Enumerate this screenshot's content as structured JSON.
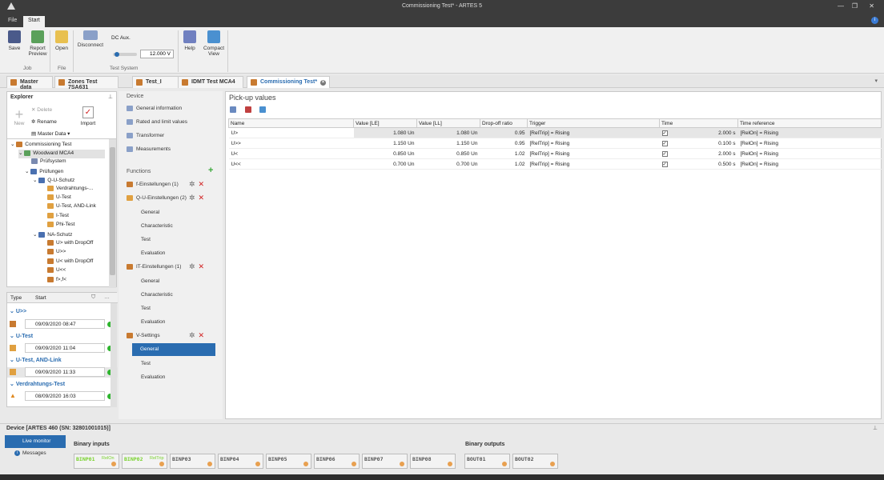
{
  "window": {
    "title": "Commissioning Test* - ARTES 5"
  },
  "menu": {
    "file": "File",
    "start": "Start"
  },
  "ribbon": {
    "save": "Save",
    "report_preview": "Report Preview",
    "open": "Open",
    "disconnect": "Disconnect",
    "dc_aux": "DC Aux.",
    "dc_aux_value": "12.000 V",
    "help": "Help",
    "compact_view": "Compact View",
    "group_job": "Job",
    "group_file": "File",
    "group_test_system": "Test System"
  },
  "tabs": [
    "Master data",
    "Zones Test 7SA631",
    "Test_I",
    "IDMT Test MCA4",
    "Commissioning Test*"
  ],
  "explorer": {
    "title": "Explorer",
    "delete": "Delete",
    "rename": "Rename",
    "new": "New",
    "master_data": "Master Data",
    "import": "Import",
    "tree": [
      {
        "label": "Commissioning Test",
        "level": 0
      },
      {
        "label": "Woodward MCA4",
        "level": 1
      },
      {
        "label": "Prüfsystem",
        "level": 2
      },
      {
        "label": "Prüfungen",
        "level": 2
      },
      {
        "label": "Q-U-Schutz",
        "level": 3
      },
      {
        "label": "Verdrahtungs-...",
        "level": 4
      },
      {
        "label": "U-Test",
        "level": 4
      },
      {
        "label": "U-Test, AND-Link",
        "level": 4
      },
      {
        "label": "I-Test",
        "level": 4
      },
      {
        "label": "Phi-Test",
        "level": 4
      },
      {
        "label": "NA-Schutz",
        "level": 3
      },
      {
        "label": "U> with DropOff",
        "level": 4
      },
      {
        "label": "U>>",
        "level": 4
      },
      {
        "label": "U< with DropOff",
        "level": 4
      },
      {
        "label": "U<<",
        "level": 4
      },
      {
        "label": "f>,f<",
        "level": 4
      }
    ]
  },
  "history": {
    "col_type": "Type",
    "col_start": "Start",
    "groups": [
      {
        "name": "U>>",
        "date": "09/09/2020 08:47"
      },
      {
        "name": "U-Test",
        "date": "09/09/2020 11:04"
      },
      {
        "name": "U-Test, AND-Link",
        "date": "09/09/2020 11:33"
      },
      {
        "name": "Verdrahtungs-Test",
        "date": "08/09/2020 16:03"
      }
    ]
  },
  "device": {
    "head": "Device",
    "items": [
      "General information",
      "Rated and limit values",
      "Transformer",
      "Measurements"
    ],
    "functions_head": "Functions",
    "functions": [
      {
        "name": "f-Einstellungen (1)",
        "subs": []
      },
      {
        "name": "Q-U-Einstellungen (2)",
        "subs": [
          "General",
          "Characteristic",
          "Test",
          "Evaluation"
        ]
      },
      {
        "name": "IT-Einstellungen (1)",
        "subs": [
          "General",
          "Characteristic",
          "Test",
          "Evaluation"
        ]
      },
      {
        "name": "V-Settings",
        "subs": [
          "General",
          "Test",
          "Evaluation"
        ]
      }
    ]
  },
  "pickup": {
    "title": "Pick-up values",
    "columns": [
      "Name",
      "Value [LE]",
      "Value [LL]",
      "Drop-off ratio",
      "Trigger",
      "Time",
      "Time reference"
    ],
    "rows": [
      {
        "name": "U>",
        "le": "1.080 Un",
        "ll": "1.080 Un",
        "ratio": "0.95",
        "trigger": "[RelTrip] = Rising",
        "time": "2.000 s",
        "ref": "[RelOn] = Rising"
      },
      {
        "name": "U>>",
        "le": "1.150 Un",
        "ll": "1.150 Un",
        "ratio": "0.95",
        "trigger": "[RelTrip] = Rising",
        "time": "0.100 s",
        "ref": "[RelOn] = Rising"
      },
      {
        "name": "U<",
        "le": "0.850 Un",
        "ll": "0.850 Un",
        "ratio": "1.02",
        "trigger": "[RelTrip] = Rising",
        "time": "2.000 s",
        "ref": "[RelOn] = Rising"
      },
      {
        "name": "U<<",
        "le": "0.700 Un",
        "ll": "0.700 Un",
        "ratio": "1.02",
        "trigger": "[RelTrip] = Rising",
        "time": "0.500 s",
        "ref": "[RelOn] = Rising"
      }
    ]
  },
  "devicebar": {
    "title": "Device [ARTES 460 (SN: 32801001015)]",
    "live_monitor": "Live monitor",
    "messages": "Messages",
    "binary_inputs": "Binary inputs",
    "binary_outputs": "Binary outputs",
    "inputs": [
      {
        "name": "BINP01",
        "state": "RelOn"
      },
      {
        "name": "BINP02",
        "state": "RelTrip"
      },
      {
        "name": "BINP03",
        "state": ""
      },
      {
        "name": "BINP04",
        "state": ""
      },
      {
        "name": "BINP05",
        "state": ""
      },
      {
        "name": "BINP06",
        "state": ""
      },
      {
        "name": "BINP07",
        "state": ""
      },
      {
        "name": "BINP08",
        "state": ""
      }
    ],
    "outputs": [
      {
        "name": "BOUT01"
      },
      {
        "name": "BOUT02"
      }
    ]
  }
}
